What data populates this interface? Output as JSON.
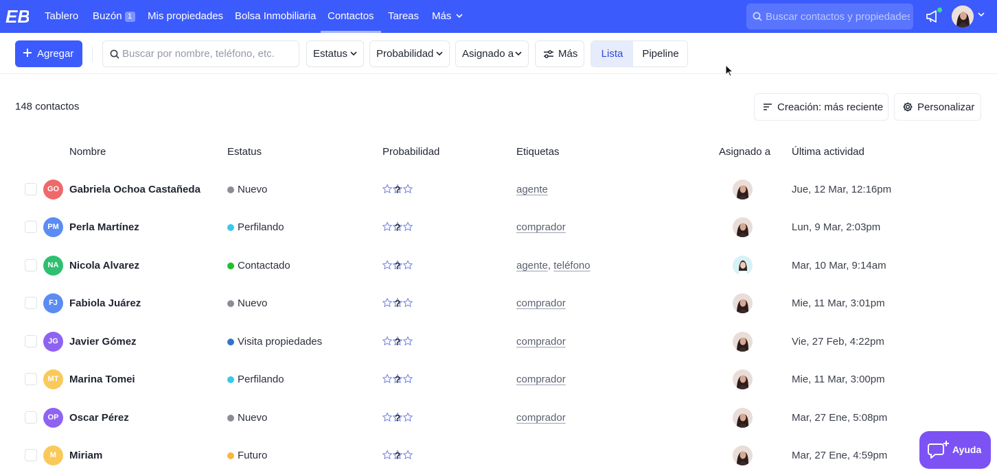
{
  "nav": {
    "logo": "EB",
    "items": [
      {
        "label": "Tablero"
      },
      {
        "label": "Buzón",
        "badge": "1"
      },
      {
        "label": "Mis propiedades"
      },
      {
        "label": "Bolsa Inmobiliaria"
      },
      {
        "label": "Contactos",
        "active": true
      },
      {
        "label": "Tareas"
      },
      {
        "label": "Más"
      }
    ],
    "search_placeholder": "Buscar contactos y propiedades"
  },
  "toolbar": {
    "add_label": "Agregar",
    "search_placeholder": "Buscar por nombre, teléfono, etc.",
    "filters": {
      "status": "Estatus",
      "probability": "Probabilidad",
      "assigned": "Asignado a",
      "more": "Más"
    },
    "views": {
      "list": "Lista",
      "pipeline": "Pipeline",
      "active": "Lista"
    }
  },
  "summary": {
    "count_label": "148 contactos",
    "sort_label": "Creación: más reciente",
    "customize_label": "Personalizar"
  },
  "table": {
    "columns": {
      "name": "Nombre",
      "status": "Estatus",
      "probability": "Probabilidad",
      "tags": "Etiquetas",
      "assigned": "Asignado a",
      "activity": "Última actividad"
    },
    "rows": [
      {
        "initials": "GO",
        "avatar_color": "#f0686a",
        "name": "Gabriela Ochoa Castañeda",
        "status": "Nuevo",
        "status_color": "#8a8d96",
        "tags": [
          "agente"
        ],
        "assignee": "woman-dark",
        "activity": "Jue, 12 Mar, 12:16pm"
      },
      {
        "initials": "PM",
        "avatar_color": "#5b8cf3",
        "name": "Perla Martínez",
        "status": "Perfilando",
        "status_color": "#36c9ee",
        "tags": [
          "comprador"
        ],
        "assignee": "woman-dark",
        "activity": "Lun, 9 Mar, 2:03pm"
      },
      {
        "initials": "NA",
        "avatar_color": "#2ec070",
        "name": "Nicola Alvarez",
        "status": "Contactado",
        "status_color": "#1ec12b",
        "tags": [
          "agente",
          "teléfono"
        ],
        "assignee": "woman-light",
        "activity": "Mar, 10 Mar, 9:14am"
      },
      {
        "initials": "FJ",
        "avatar_color": "#5b8cf3",
        "name": "Fabiola Juárez",
        "status": "Nuevo",
        "status_color": "#8a8d96",
        "tags": [
          "comprador"
        ],
        "assignee": "woman-dark",
        "activity": "Mie, 11 Mar, 3:01pm"
      },
      {
        "initials": "JG",
        "avatar_color": "#8e63f2",
        "name": "Javier Gómez",
        "status": "Visita propiedades",
        "status_color": "#2f74d0",
        "tags": [
          "comprador"
        ],
        "assignee": "woman-dark",
        "activity": "Vie, 27 Feb, 4:22pm"
      },
      {
        "initials": "MT",
        "avatar_color": "#f9c95a",
        "name": "Marina Tomei",
        "status": "Perfilando",
        "status_color": "#36c9ee",
        "tags": [
          "comprador"
        ],
        "assignee": "woman-dark",
        "activity": "Mie, 11 Mar, 3:00pm"
      },
      {
        "initials": "OP",
        "avatar_color": "#8e63f2",
        "name": "Oscar Pérez",
        "status": "Nuevo",
        "status_color": "#8a8d96",
        "tags": [
          "comprador"
        ],
        "assignee": "woman-dark",
        "activity": "Mar, 27 Ene, 5:08pm"
      },
      {
        "initials": "M",
        "avatar_color": "#f9c95a",
        "name": "Miriam",
        "status": "Futuro",
        "status_color": "#f8b73c",
        "tags": [],
        "assignee": "woman-dark",
        "activity": "Mar, 27 Ene, 4:59pm"
      }
    ]
  },
  "help": {
    "label": "Ayuda"
  },
  "colors": {
    "primary": "#3b5bfd",
    "help": "#7d52f4",
    "selected_view_bg": "#e7ecfd"
  }
}
